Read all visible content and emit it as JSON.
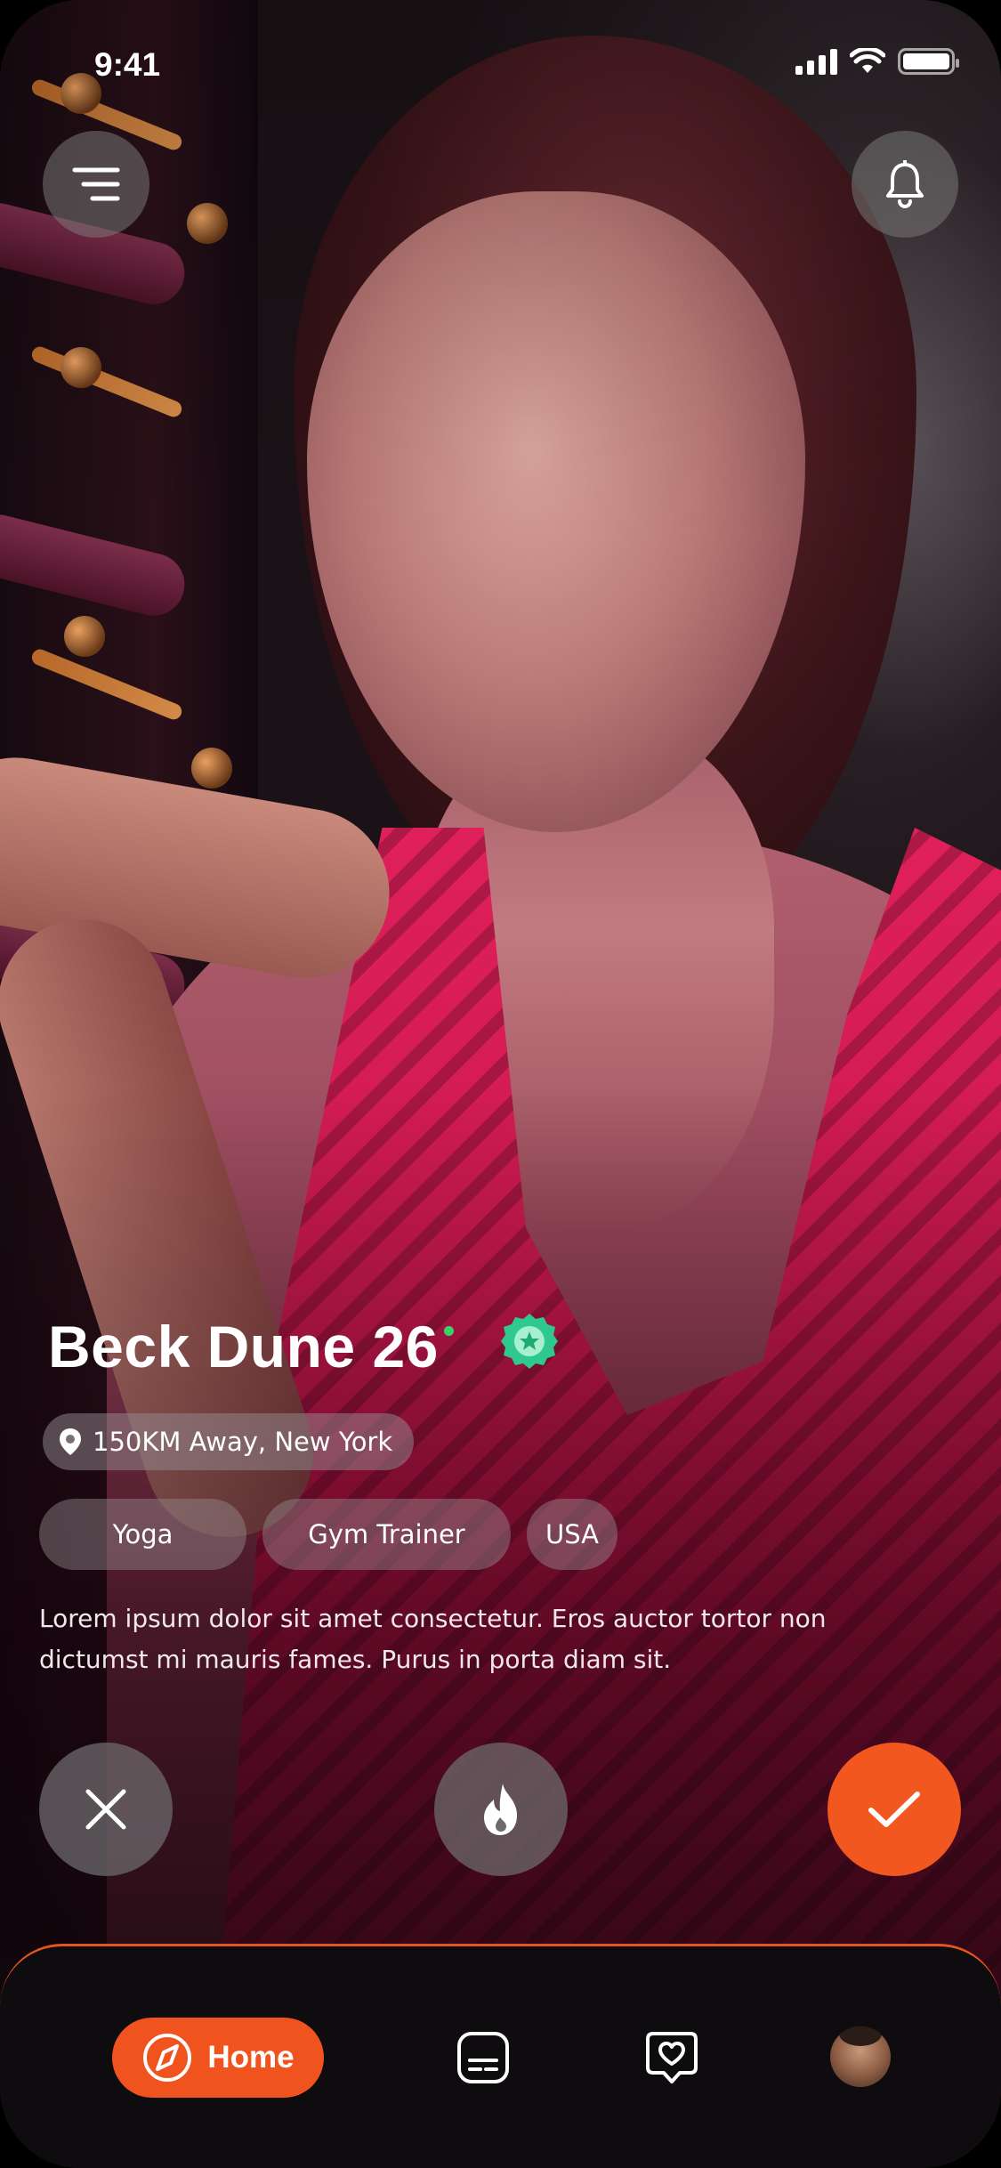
{
  "status_bar": {
    "time": "9:41"
  },
  "profile": {
    "name": "Beck Dune",
    "age": "26",
    "location": "150KM Away, New York",
    "tags": [
      "Yoga",
      "Gym Trainer",
      "USA"
    ],
    "bio": "Lorem ipsum dolor sit amet consectetur. Eros auctor tortor non dictumst mi mauris fames. Purus in porta diam sit.",
    "online": true,
    "verified": true
  },
  "nav": {
    "home_label": "Home",
    "active": "home"
  },
  "colors": {
    "accent": "#F2571F",
    "online": "#38D26A",
    "verified": "#2FC98E",
    "nav_bg": "#0E0C0F"
  },
  "icons": {
    "menu": "menu-icon",
    "bell": "bell-icon",
    "location": "location-pin-icon",
    "verified": "verified-badge-icon",
    "reject": "close-icon",
    "boost": "flame-icon",
    "accept": "check-icon",
    "home": "compass-icon",
    "chat": "chat-icon",
    "likes": "heart-message-icon"
  }
}
